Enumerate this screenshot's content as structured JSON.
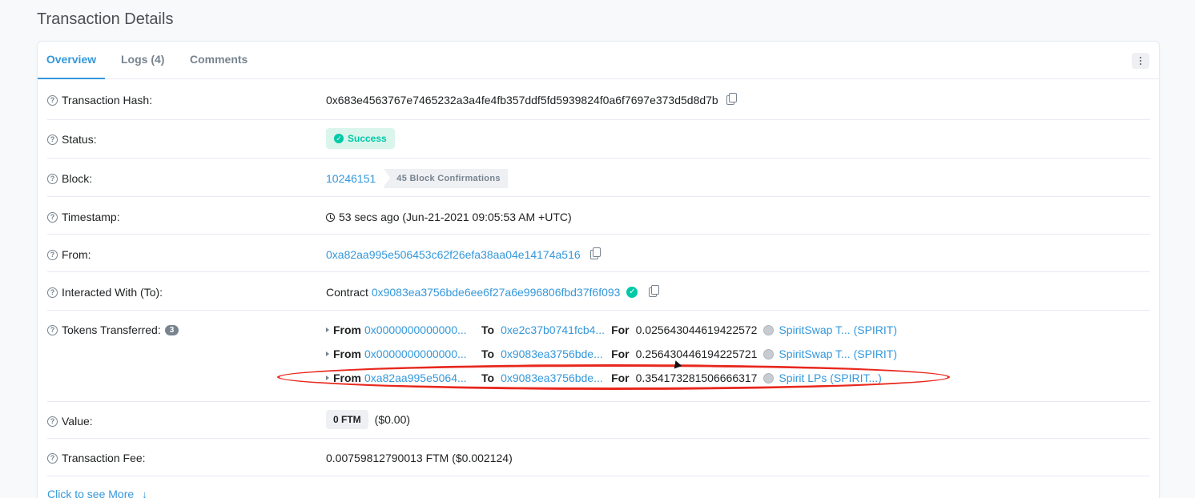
{
  "page": {
    "title": "Transaction Details"
  },
  "tabs": [
    {
      "label": "Overview"
    },
    {
      "label": "Logs (4)"
    },
    {
      "label": "Comments"
    }
  ],
  "rows": {
    "tx_hash": {
      "label": "Transaction Hash:",
      "value": "0x683e4563767e7465232a3a4fe4fb357ddf5fd5939824f0a6f7697e373d5d8d7b"
    },
    "status": {
      "label": "Status:",
      "value": "Success"
    },
    "block": {
      "label": "Block:",
      "value": "10246151",
      "confirmations": "45 Block Confirmations"
    },
    "timestamp": {
      "label": "Timestamp:",
      "value": "53 secs ago (Jun-21-2021 09:05:53 AM +UTC)"
    },
    "from": {
      "label": "From:",
      "value": "0xa82aa995e506453c62f26efa38aa04e14174a516"
    },
    "to": {
      "label": "Interacted With (To):",
      "prefix": "Contract",
      "value": "0x9083ea3756bde6ee6f27a6e996806fbd37f6f093"
    },
    "tokens": {
      "label": "Tokens Transferred:",
      "count": "3",
      "from_kw": "From",
      "to_kw": "To",
      "for_kw": "For",
      "transfers": [
        {
          "from": "0x0000000000000...",
          "to": "0xe2c37b0741fcb4...",
          "amount": "0.025643044619422572",
          "token": "SpiritSwap T... (SPIRIT)"
        },
        {
          "from": "0x0000000000000...",
          "to": "0x9083ea3756bde...",
          "amount": "0.256430446194225721",
          "token": "SpiritSwap T... (SPIRIT)"
        },
        {
          "from": "0xa82aa995e5064...",
          "to": "0x9083ea3756bde...",
          "amount": "0.354173281506666317",
          "token": "Spirit LPs (SPIRIT...)"
        }
      ]
    },
    "value": {
      "label": "Value:",
      "badge": "0 FTM",
      "usd": "($0.00)"
    },
    "fee": {
      "label": "Transaction Fee:",
      "value": "0.00759812790013 FTM ($0.002124)"
    }
  },
  "see_more": {
    "label": "Click to see More"
  },
  "colors": {
    "accent": "#3498db",
    "success": "#00c9a7",
    "annotation": "#e8271d"
  }
}
